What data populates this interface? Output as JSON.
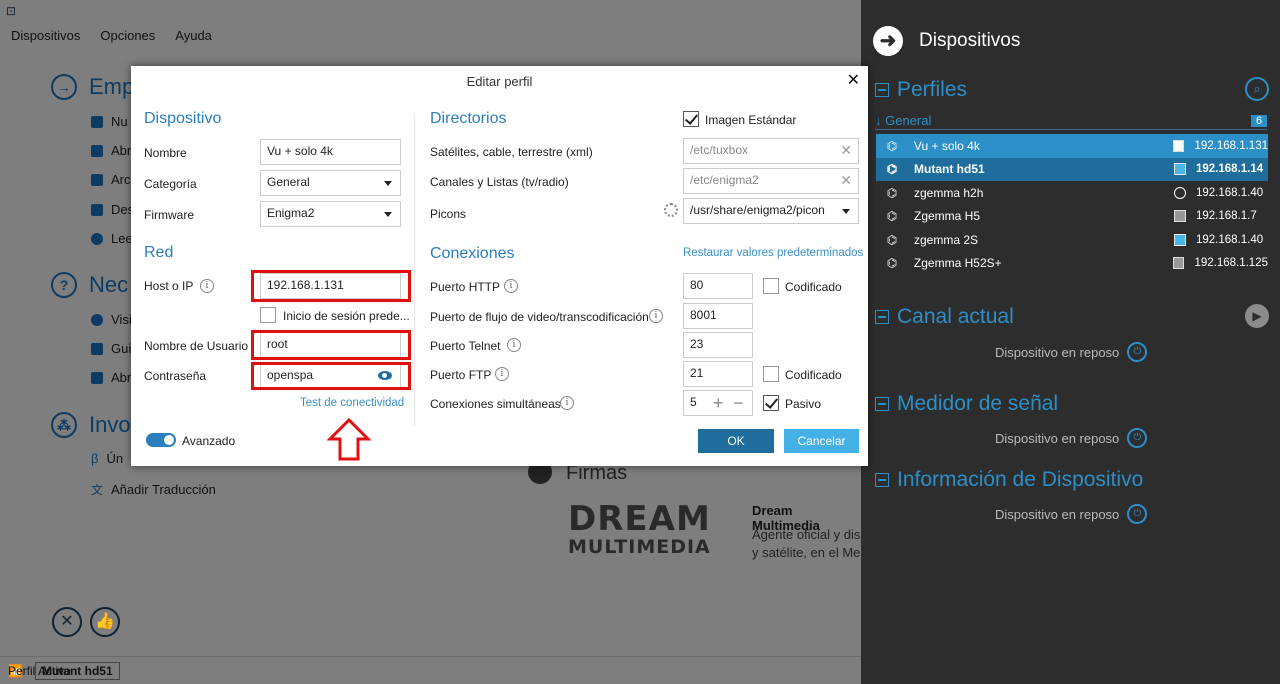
{
  "menubar": [
    "Dispositivos",
    "Opciones",
    "Ayuda"
  ],
  "background": {
    "sections": [
      {
        "title": "Emp",
        "items": [
          "Nu",
          "Abr",
          "Arc",
          "Des",
          "Lee"
        ]
      },
      {
        "title": "Nec",
        "items": [
          "Visi",
          "Gui",
          "Abr"
        ]
      },
      {
        "title": "Invo",
        "items": [
          "Ún",
          "Añadir Traducción"
        ]
      }
    ],
    "firmas_title": "Firmas",
    "logo_line1": "DREAM",
    "logo_line2": "MULTIMEDIA",
    "firm_name": "Dream Multimedia",
    "firm_desc_1": "Agente oficial y dis",
    "firm_desc_2": "y satélite, en el Me"
  },
  "statusbar": {
    "label": "Perfil Activo",
    "active_profile": "Mutant hd51"
  },
  "side": {
    "title": "Dispositivos",
    "perfiles": "Perfiles",
    "general_label": "General",
    "general_count": "6",
    "devices": [
      {
        "name": "Vu + solo 4k",
        "ip": "192.168.1.131"
      },
      {
        "name": "Mutant hd51",
        "ip": "192.168.1.14"
      },
      {
        "name": "zgemma h2h",
        "ip": "192.168.1.40"
      },
      {
        "name": "Zgemma H5",
        "ip": "192.168.1.7"
      },
      {
        "name": "zgemma 2S",
        "ip": "192.168.1.40"
      },
      {
        "name": "Zgemma H52S+",
        "ip": "192.168.1.125"
      }
    ],
    "canal_actual": "Canal actual",
    "medidor": "Medidor de señal",
    "info_dispositivo": "Información de Dispositivo",
    "reposo": "Dispositivo en reposo"
  },
  "dialog": {
    "title": "Editar perfil",
    "dispositivo": {
      "heading": "Dispositivo",
      "nombre_label": "Nombre",
      "nombre_value": "Vu + solo 4k",
      "categoria_label": "Categoría",
      "categoria_value": "General",
      "firmware_label": "Firmware",
      "firmware_value": "Enigma2"
    },
    "red": {
      "heading": "Red",
      "host_label": "Host o IP",
      "host_value": "192.168.1.131",
      "inicio_label": "Inicio de sesión prede...",
      "usuario_label": "Nombre de Usuario",
      "usuario_value": "root",
      "password_label": "Contraseña",
      "password_value": "openspa",
      "test_link": "Test de conectividad"
    },
    "directorios": {
      "heading": "Directorios",
      "imagen_estandar": "Imagen Estándar",
      "satelites_label": "Satélites, cable, terrestre (xml)",
      "satelites_value": "/etc/tuxbox",
      "canales_label": "Canales y Listas (tv/radio)",
      "canales_value": "/etc/enigma2",
      "picons_label": "Picons",
      "picons_value": "/usr/share/enigma2/picon"
    },
    "conexiones": {
      "heading": "Conexiones",
      "restaurar": "Restaurar valores predeterminados",
      "http_label": "Puerto HTTP",
      "http_value": "80",
      "codificado": "Codificado",
      "stream_label": "Puerto de flujo de video/transcodificación",
      "stream_value": "8001",
      "telnet_label": "Puerto Telnet",
      "telnet_value": "23",
      "ftp_label": "Puerto FTP",
      "ftp_value": "21",
      "simult_label": "Conexiones simultáneas",
      "simult_value": "5",
      "pasivo": "Pasivo"
    },
    "avanzado": "Avanzado",
    "ok": "OK",
    "cancel": "Cancelar"
  },
  "colors": {
    "accent": "#2a7fbf",
    "highlight": "#e01010",
    "side_bg": "#2d2d2d"
  }
}
